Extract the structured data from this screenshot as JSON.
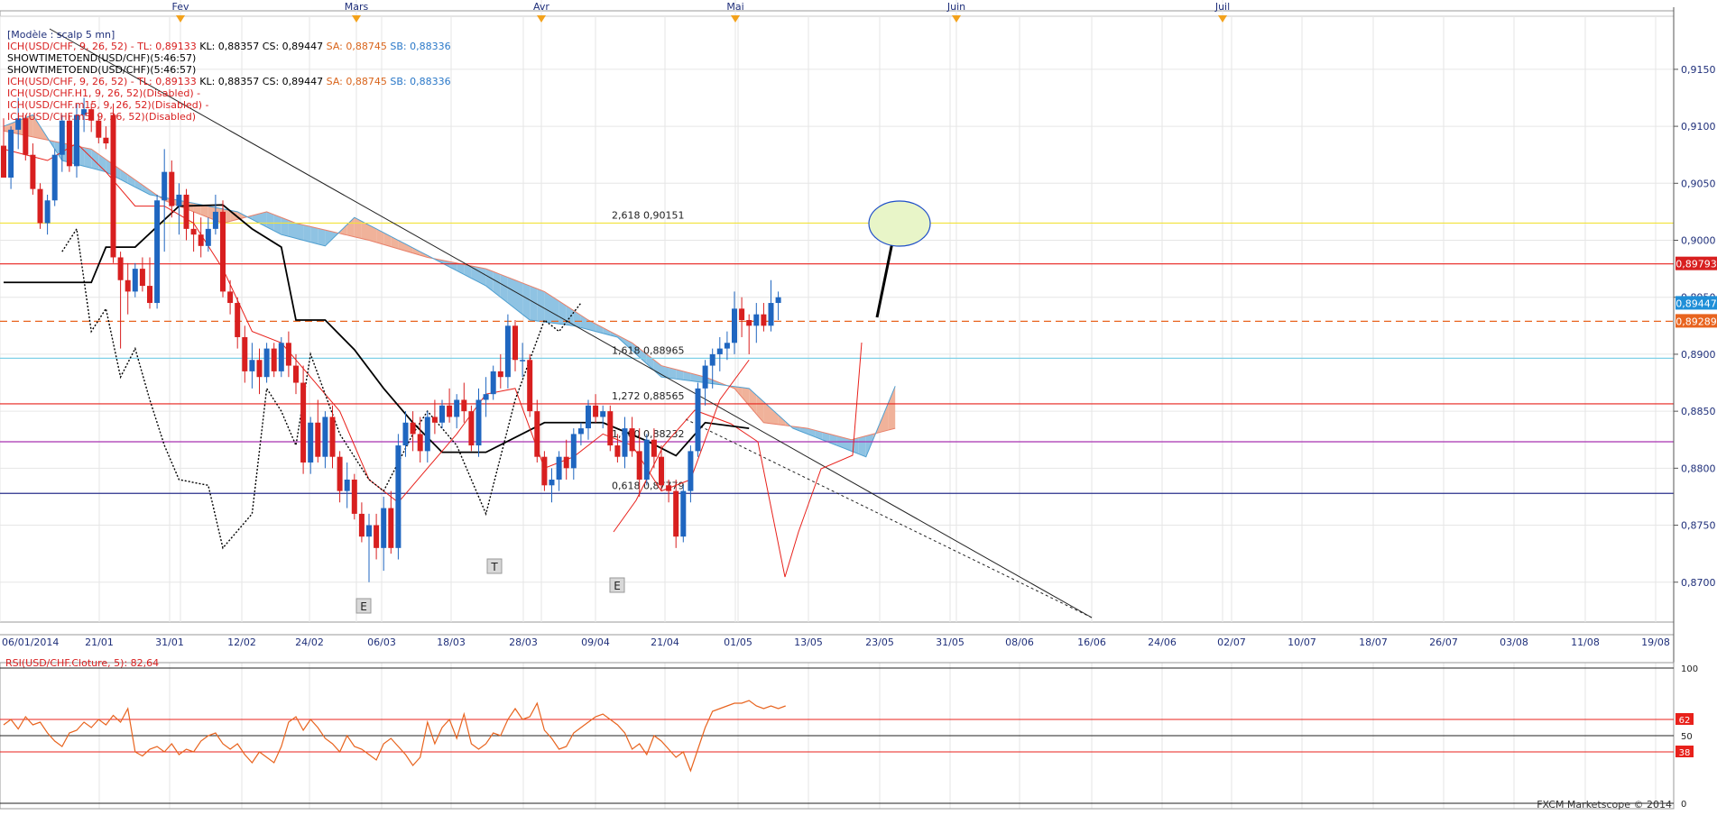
{
  "instrument": "USD/CHF",
  "months": [
    "Fev",
    "Mars",
    "Avr",
    "Mai",
    "Juin",
    "Juil"
  ],
  "info_lines": [
    [
      {
        "t": "[Modèle : scalp 5 mn]",
        "c": "navy"
      }
    ],
    [
      {
        "t": "ICH(USD/CHF, 9, 26, 52) -  TL: 0,89133",
        "c": "red"
      },
      {
        "t": "  KL: 0,88357  CS: 0,89447",
        "c": "black"
      },
      {
        "t": "  SA: 0,88745",
        "c": "orange"
      },
      {
        "t": "  SB: 0,88336",
        "c": "blue"
      }
    ],
    [
      {
        "t": "SHOWTIMETOEND(USD/CHF)(5:46:57)",
        "c": "black"
      }
    ],
    [
      {
        "t": "SHOWTIMETOEND(USD/CHF)(5:46:57)",
        "c": "black"
      }
    ],
    [
      {
        "t": "ICH(USD/CHF, 9, 26, 52) -  TL: 0,89133",
        "c": "red"
      },
      {
        "t": "  KL: 0,88357  CS: 0,89447",
        "c": "black"
      },
      {
        "t": "  SA: 0,88745",
        "c": "orange"
      },
      {
        "t": "  SB: 0,88336",
        "c": "blue"
      }
    ],
    [
      {
        "t": "ICH(USD/CHF.H1, 9, 26, 52)(Disabled) -",
        "c": "red"
      }
    ],
    [
      {
        "t": "ICH(USD/CHF.m15, 9, 26, 52)(Disabled) -",
        "c": "red"
      }
    ],
    [
      {
        "t": "ICH(USD/CHF.m5, 9, 26, 52)(Disabled)",
        "c": "red"
      }
    ]
  ],
  "rsi_label": "RSI(USD/CHF.Cloture, 5): 82,64",
  "copyright": "FXCM Marketscope © 2014",
  "colors": {
    "up": "#1f66c0",
    "down": "#d81f1f",
    "kumo_bear": "#f0b29a",
    "kumo_bull": "#8fc3e3",
    "fibo": "#f2e23a",
    "rsi": "#e8641f",
    "tenkan": "#e8211b",
    "kijun": "#000000"
  },
  "chart_data": {
    "type": "candlestick",
    "ylim": [
      0.8665,
      0.9195
    ],
    "y_ticks": [
      0.87,
      0.875,
      0.88,
      0.885,
      0.89,
      0.895,
      0.9,
      0.905,
      0.91,
      0.915
    ],
    "y_tick_labels": [
      "0,8700",
      "0,8750",
      "0,8800",
      "0,8850",
      "0,8900",
      "0,8950",
      "0,9000",
      "0,9050",
      "0,9100",
      "0,9150"
    ],
    "x_tick_labels": [
      "06/01/2014",
      "21/01",
      "31/01",
      "12/02",
      "24/02",
      "06/03",
      "18/03",
      "28/03",
      "09/04",
      "21/04",
      "01/05",
      "13/05",
      "23/05",
      "31/05",
      "08/06",
      "16/06",
      "24/06",
      "02/07",
      "10/07",
      "18/07",
      "26/07",
      "03/08",
      "11/08",
      "19/08"
    ],
    "candles": [
      [
        0.9083,
        0.9107,
        0.9055,
        0.9055
      ],
      [
        0.9055,
        0.91,
        0.9045,
        0.9097
      ],
      [
        0.9097,
        0.9125,
        0.908,
        0.9107
      ],
      [
        0.9107,
        0.911,
        0.907,
        0.9075
      ],
      [
        0.9075,
        0.9085,
        0.904,
        0.9045
      ],
      [
        0.9045,
        0.905,
        0.901,
        0.9015
      ],
      [
        0.9015,
        0.904,
        0.9005,
        0.9035
      ],
      [
        0.9035,
        0.908,
        0.903,
        0.9075
      ],
      [
        0.9075,
        0.911,
        0.906,
        0.9105
      ],
      [
        0.9105,
        0.911,
        0.906,
        0.9065
      ],
      [
        0.9065,
        0.912,
        0.9055,
        0.911
      ],
      [
        0.911,
        0.9125,
        0.9095,
        0.9115
      ],
      [
        0.9115,
        0.912,
        0.9095,
        0.9105
      ],
      [
        0.9105,
        0.911,
        0.9085,
        0.909
      ],
      [
        0.909,
        0.91,
        0.908,
        0.9085
      ],
      [
        0.911,
        0.912,
        0.898,
        0.8985
      ],
      [
        0.8985,
        0.899,
        0.8905,
        0.8965
      ],
      [
        0.8965,
        0.898,
        0.8935,
        0.8955
      ],
      [
        0.8955,
        0.898,
        0.895,
        0.8975
      ],
      [
        0.8975,
        0.8985,
        0.8955,
        0.896
      ],
      [
        0.896,
        0.8985,
        0.894,
        0.8945
      ],
      [
        0.8945,
        0.904,
        0.894,
        0.9035
      ],
      [
        0.9035,
        0.908,
        0.899,
        0.906
      ],
      [
        0.906,
        0.907,
        0.902,
        0.903
      ],
      [
        0.903,
        0.905,
        0.9005,
        0.904
      ],
      [
        0.904,
        0.9045,
        0.9,
        0.901
      ],
      [
        0.901,
        0.9025,
        0.899,
        0.9005
      ],
      [
        0.9005,
        0.902,
        0.8985,
        0.8995
      ],
      [
        0.8995,
        0.902,
        0.899,
        0.901
      ],
      [
        0.901,
        0.904,
        0.9005,
        0.9025
      ],
      [
        0.9025,
        0.9035,
        0.895,
        0.8955
      ],
      [
        0.8955,
        0.8965,
        0.8935,
        0.8945
      ],
      [
        0.8945,
        0.895,
        0.8905,
        0.8915
      ],
      [
        0.8915,
        0.8925,
        0.8875,
        0.8885
      ],
      [
        0.8885,
        0.891,
        0.887,
        0.8895
      ],
      [
        0.8895,
        0.8905,
        0.8865,
        0.888
      ],
      [
        0.888,
        0.891,
        0.8875,
        0.8905
      ],
      [
        0.8905,
        0.891,
        0.888,
        0.8885
      ],
      [
        0.8885,
        0.8915,
        0.888,
        0.891
      ],
      [
        0.891,
        0.892,
        0.888,
        0.889
      ],
      [
        0.889,
        0.89,
        0.8865,
        0.8875
      ],
      [
        0.8875,
        0.889,
        0.8795,
        0.8805
      ],
      [
        0.8805,
        0.8845,
        0.8795,
        0.884
      ],
      [
        0.884,
        0.886,
        0.8805,
        0.881
      ],
      [
        0.881,
        0.885,
        0.88,
        0.8845
      ],
      [
        0.8845,
        0.8855,
        0.88,
        0.881
      ],
      [
        0.881,
        0.8815,
        0.877,
        0.878
      ],
      [
        0.878,
        0.8805,
        0.8765,
        0.879
      ],
      [
        0.879,
        0.8795,
        0.8755,
        0.876
      ],
      [
        0.876,
        0.877,
        0.8735,
        0.874
      ],
      [
        0.874,
        0.876,
        0.87,
        0.875
      ],
      [
        0.875,
        0.876,
        0.872,
        0.873
      ],
      [
        0.873,
        0.8775,
        0.871,
        0.8765
      ],
      [
        0.8765,
        0.878,
        0.8725,
        0.873
      ],
      [
        0.873,
        0.883,
        0.872,
        0.882
      ],
      [
        0.882,
        0.885,
        0.881,
        0.884
      ],
      [
        0.884,
        0.885,
        0.8815,
        0.883
      ],
      [
        0.883,
        0.8845,
        0.8805,
        0.8815
      ],
      [
        0.8815,
        0.885,
        0.8805,
        0.8845
      ],
      [
        0.8845,
        0.886,
        0.883,
        0.884
      ],
      [
        0.884,
        0.886,
        0.8835,
        0.8855
      ],
      [
        0.8855,
        0.887,
        0.884,
        0.8845
      ],
      [
        0.8845,
        0.8865,
        0.8835,
        0.886
      ],
      [
        0.886,
        0.8875,
        0.884,
        0.885
      ],
      [
        0.885,
        0.8855,
        0.8815,
        0.882
      ],
      [
        0.882,
        0.887,
        0.881,
        0.886
      ],
      [
        0.886,
        0.888,
        0.8845,
        0.8865
      ],
      [
        0.8865,
        0.889,
        0.886,
        0.8885
      ],
      [
        0.8885,
        0.89,
        0.887,
        0.888
      ],
      [
        0.888,
        0.8935,
        0.887,
        0.8925
      ],
      [
        0.8925,
        0.893,
        0.8885,
        0.8895
      ],
      [
        0.8895,
        0.891,
        0.888,
        0.8895
      ],
      [
        0.8895,
        0.89,
        0.8845,
        0.885
      ],
      [
        0.885,
        0.886,
        0.8805,
        0.881
      ],
      [
        0.881,
        0.8815,
        0.878,
        0.8785
      ],
      [
        0.8785,
        0.88,
        0.877,
        0.879
      ],
      [
        0.879,
        0.8815,
        0.878,
        0.881
      ],
      [
        0.881,
        0.8825,
        0.879,
        0.88
      ],
      [
        0.88,
        0.8835,
        0.879,
        0.883
      ],
      [
        0.883,
        0.884,
        0.882,
        0.8835
      ],
      [
        0.8835,
        0.886,
        0.8825,
        0.8855
      ],
      [
        0.8855,
        0.8865,
        0.884,
        0.8845
      ],
      [
        0.8845,
        0.8855,
        0.8835,
        0.885
      ],
      [
        0.885,
        0.8855,
        0.8815,
        0.882
      ],
      [
        0.882,
        0.883,
        0.8805,
        0.881
      ],
      [
        0.881,
        0.8845,
        0.88,
        0.8835
      ],
      [
        0.8835,
        0.8845,
        0.881,
        0.8815
      ],
      [
        0.8815,
        0.8835,
        0.8775,
        0.879
      ],
      [
        0.879,
        0.883,
        0.8785,
        0.8825
      ],
      [
        0.8825,
        0.8835,
        0.88,
        0.881
      ],
      [
        0.881,
        0.882,
        0.878,
        0.8785
      ],
      [
        0.8785,
        0.879,
        0.877,
        0.878
      ],
      [
        0.878,
        0.879,
        0.873,
        0.874
      ],
      [
        0.874,
        0.8785,
        0.8735,
        0.878
      ],
      [
        0.878,
        0.882,
        0.877,
        0.8815
      ],
      [
        0.8815,
        0.8875,
        0.881,
        0.887
      ],
      [
        0.887,
        0.8895,
        0.8855,
        0.889
      ],
      [
        0.889,
        0.8905,
        0.887,
        0.89
      ],
      [
        0.89,
        0.8915,
        0.8885,
        0.8905
      ],
      [
        0.8905,
        0.892,
        0.8895,
        0.891
      ],
      [
        0.891,
        0.8955,
        0.89,
        0.894
      ],
      [
        0.894,
        0.895,
        0.8915,
        0.893
      ],
      [
        0.893,
        0.8935,
        0.89,
        0.8925
      ],
      [
        0.8925,
        0.8945,
        0.891,
        0.8935
      ],
      [
        0.8935,
        0.8945,
        0.892,
        0.8925
      ],
      [
        0.8925,
        0.8965,
        0.892,
        0.8945
      ],
      [
        0.8945,
        0.8955,
        0.893,
        0.895
      ]
    ],
    "horizontal_levels": [
      {
        "value": 0.90151,
        "color": "#f2e23a",
        "label": "2,618 0,90151"
      },
      {
        "value": 0.88965,
        "color": "#7fd0e8",
        "label": "1,618 0,88965"
      },
      {
        "value": 0.88565,
        "color": "#e8211b",
        "label": "1,272 0,88565"
      },
      {
        "value": 0.88232,
        "color": "#a832b0",
        "label": "1,000 0,88232"
      },
      {
        "value": 0.87779,
        "color": "#2a2f8c",
        "label": "0,618 0,87779"
      },
      {
        "value": 0.89793,
        "color": "#e8211b",
        "label": ""
      },
      {
        "value": 0.89289,
        "color": "#e8641f",
        "label": "",
        "dashed": true
      }
    ],
    "price_tags": [
      {
        "label": "0,89793",
        "bg": "#d81f1f"
      },
      {
        "label": "0,89447",
        "bg": "#1f8fd8"
      },
      {
        "label": "0,89289",
        "bg": "#e8641f"
      }
    ],
    "annotations": [
      "E",
      "T",
      "E"
    ],
    "rsi": {
      "ylim": [
        0,
        100
      ],
      "levels": [
        100,
        62,
        50,
        38,
        0
      ],
      "level_labels": [
        "100",
        "62",
        "50",
        "38",
        "0"
      ],
      "values": [
        58,
        62,
        55,
        64,
        58,
        60,
        52,
        46,
        42,
        52,
        54,
        60,
        56,
        62,
        58,
        65,
        60,
        70,
        38,
        35,
        40,
        42,
        38,
        44,
        36,
        40,
        38,
        46,
        50,
        52,
        44,
        40,
        44,
        36,
        30,
        38,
        34,
        30,
        42,
        60,
        64,
        54,
        62,
        56,
        48,
        44,
        38,
        50,
        42,
        40,
        36,
        32,
        44,
        48,
        42,
        36,
        28,
        34,
        60,
        44,
        56,
        62,
        48,
        66,
        44,
        40,
        44,
        52,
        50,
        62,
        70,
        62,
        64,
        74,
        54,
        48,
        40,
        42,
        52,
        56,
        60,
        64,
        66,
        62,
        58,
        52,
        40,
        44,
        36,
        50,
        46,
        40,
        34,
        38,
        24,
        40,
        56,
        68,
        70,
        72,
        74,
        74,
        76,
        72,
        70,
        72,
        70,
        72
      ]
    }
  }
}
